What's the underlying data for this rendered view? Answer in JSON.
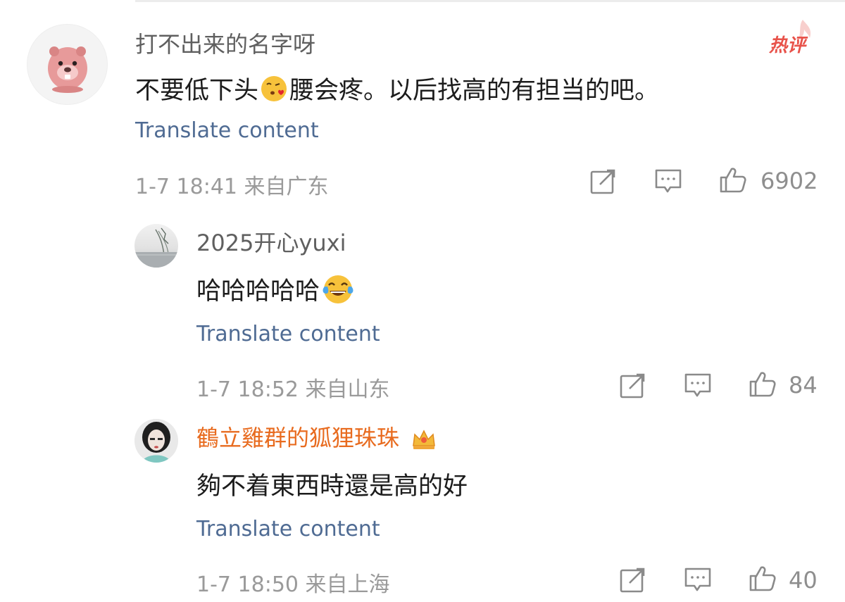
{
  "comments": [
    {
      "username": "打不出来的名字呀",
      "text_before": "不要低下头",
      "text_after": "腰会疼。以后找高的有担当的吧。",
      "emoji": "kissing-heart-emoji",
      "badge": "热评",
      "translate": "Translate content",
      "meta": "1-7 18:41 来自广东",
      "likes": "6902"
    },
    {
      "username": "2025开心yuxi",
      "text_before": "哈哈哈哈哈",
      "emoji": "tears-of-joy-emoji",
      "translate": "Translate content",
      "meta": "1-7 18:52 来自山东",
      "likes": "84"
    },
    {
      "username": "鶴立雞群的狐狸珠珠",
      "username_color": "#e86b1f",
      "crown_icon": "crown-icon",
      "text": "夠不着東西時還是高的好",
      "translate": "Translate content",
      "meta": "1-7 18:50 来自上海",
      "likes": "40"
    }
  ],
  "icons": {
    "share": "share-icon",
    "reply": "comment-icon",
    "like": "thumbs-up-icon"
  },
  "colors": {
    "link": "#4f6b93",
    "meta": "#9a9a9a",
    "hot": "#e8524a",
    "vip_name": "#e86b1f"
  }
}
